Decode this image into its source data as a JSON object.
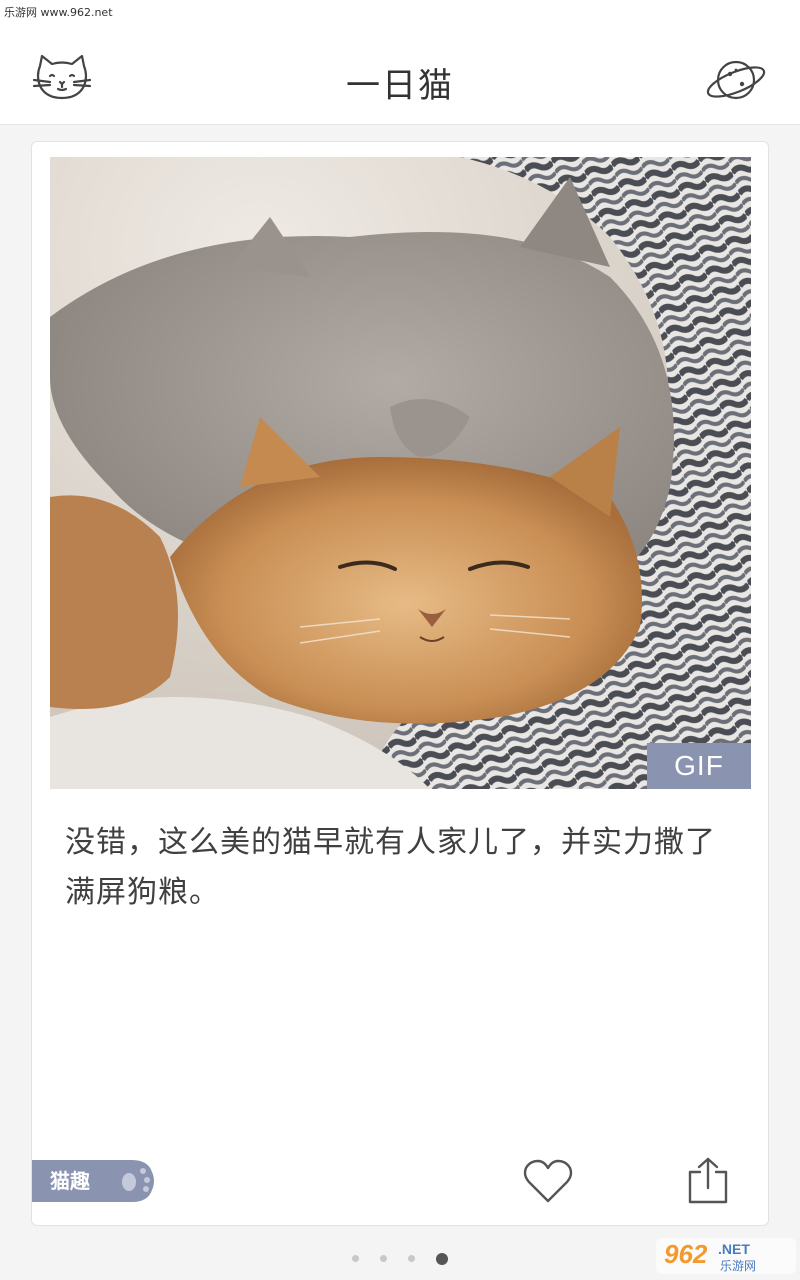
{
  "status_bar": {
    "watermark_text": "乐游网 www.962.net"
  },
  "header": {
    "title": "一日猫",
    "left_icon": "cat-face-icon",
    "right_icon": "planet-icon"
  },
  "card": {
    "media_badge": "GIF",
    "caption": "没错，这么美的猫早就有人家儿了，并实力撒了满屏狗粮。",
    "tag_label": "猫趣",
    "tag_icon": "paw-icon",
    "like_icon": "heart-icon",
    "share_icon": "share-icon"
  },
  "pagination": {
    "total": 4,
    "current": 4
  },
  "watermark_logo": {
    "brand": "962.NET",
    "sub": "乐游网"
  },
  "colors": {
    "accent": "#8a93b0",
    "header_bg": "#ffffff",
    "page_bg": "#f4f4f4",
    "text": "#404040"
  }
}
